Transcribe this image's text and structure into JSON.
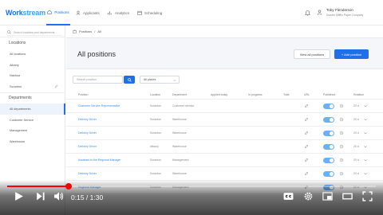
{
  "app": {
    "logo_a": "Work",
    "logo_b": "stream",
    "nav_tabs": [
      {
        "label": "Positions",
        "icon": "home-icon"
      },
      {
        "label": "Applicants",
        "icon": "person-icon"
      },
      {
        "label": "Analytics",
        "icon": "chart-icon"
      },
      {
        "label": "Scheduling",
        "icon": "calendar-icon"
      }
    ],
    "user_name": "Toby Flenderson",
    "user_company": "Dunder Mifflin Paper Company"
  },
  "sidebar": {
    "search_placeholder": "Search locations and departments",
    "locations_heading": "Locations",
    "locations": [
      "All locations",
      "Albany",
      "Nashua",
      "Scranton"
    ],
    "departments_heading": "Departments",
    "departments": [
      "All departments",
      "Customer Service",
      "Management",
      "Warehouse"
    ]
  },
  "breadcrumb": {
    "root": "Positions",
    "separator": "/",
    "current": "All"
  },
  "page": {
    "title": "All positions",
    "view_all_label": "View all positions",
    "add_label": "+ Add position"
  },
  "filters": {
    "search_placeholder": "Search position",
    "select_value": "All places"
  },
  "table": {
    "headers": [
      "Position",
      "Location",
      "Department",
      "Applied today",
      "In progress",
      "Total",
      "URL",
      "Published",
      "Rotation"
    ],
    "rows": [
      {
        "position": "Customer Service Representative",
        "location": "Scranton",
        "department": "Customer service",
        "rotation": "20 d"
      },
      {
        "position": "Delivery Driver",
        "location": "Scranton",
        "department": "Warehouse",
        "rotation": "20 d"
      },
      {
        "position": "Delivery Driver",
        "location": "Scranton",
        "department": "Warehouse",
        "rotation": "20 d"
      },
      {
        "position": "Delivery Driver",
        "location": "Albany",
        "department": "Warehouse",
        "rotation": "20 d"
      },
      {
        "position": "Assistant to the Regional Manager",
        "location": "Scranton",
        "department": "Management",
        "rotation": "20 d"
      },
      {
        "position": "Delivery Driver",
        "location": "Scranton",
        "department": "Warehouse",
        "rotation": "20 d"
      },
      {
        "position": "Regional Manager",
        "location": "Scranton",
        "department": "Management",
        "rotation": "20 d"
      }
    ]
  },
  "player": {
    "time": "0:15 / 1:30",
    "progress_fraction": 0.167,
    "colors": {
      "accent": "#ff0000",
      "brand": "#1f6feb"
    }
  }
}
